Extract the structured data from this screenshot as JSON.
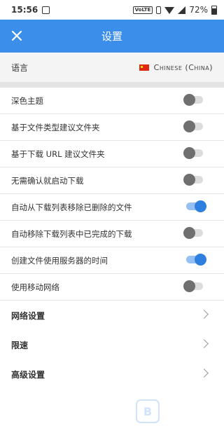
{
  "status_bar": {
    "time": "15:56",
    "network_badge": "VoLTE",
    "battery_percent": "72%"
  },
  "app_bar": {
    "title": "设置",
    "close_icon": "close-icon",
    "color": "#3b8ee9"
  },
  "language": {
    "label": "语言",
    "flag_icon": "china-flag-icon",
    "value": "Chinese (China)"
  },
  "settings": [
    {
      "label": "深色主题",
      "enabled": false
    },
    {
      "label": "基于文件类型建议文件夹",
      "enabled": false
    },
    {
      "label": "基于下载 URL 建议文件夹",
      "enabled": false
    },
    {
      "label": "无需确认就启动下载",
      "enabled": false
    },
    {
      "label": "自动从下载列表移除已删除的文件",
      "enabled": true
    },
    {
      "label": "自动移除下载列表中已完成的下载",
      "enabled": false
    },
    {
      "label": "创建文件使用服务器的时间",
      "enabled": true
    },
    {
      "label": "使用移动网络",
      "enabled": false
    }
  ],
  "nav_items": [
    {
      "label": "网络设置",
      "icon": "chevron-right-icon"
    },
    {
      "label": "限速",
      "icon": "chevron-right-icon"
    },
    {
      "label": "高级设置",
      "icon": "chevron-right-icon"
    }
  ],
  "watermark": {
    "glyph": "B",
    "text": ""
  },
  "colors": {
    "toggle_on": "#2f7fe0",
    "toggle_off": "#6f6f6f",
    "accent": "#3b8ee9"
  }
}
